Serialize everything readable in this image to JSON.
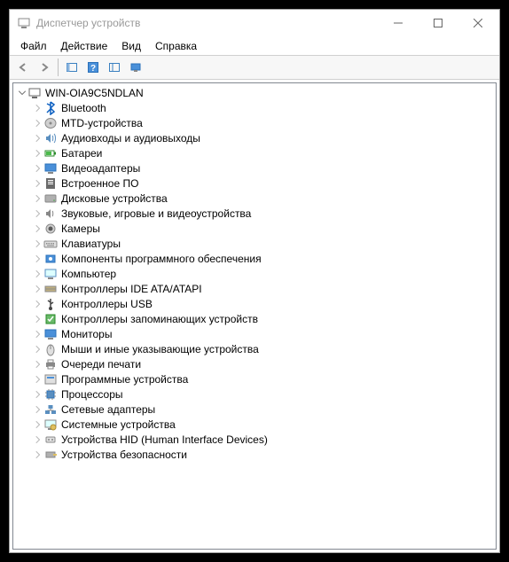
{
  "title": "Диспетчер устройств",
  "menu": [
    "Файл",
    "Действие",
    "Вид",
    "Справка"
  ],
  "root": {
    "label": "WIN-OIA9C5NDLAN",
    "icon": "computer-icon"
  },
  "categories": [
    {
      "label": "Bluetooth",
      "icon": "bluetooth-icon"
    },
    {
      "label": "MTD-устройства",
      "icon": "disk-icon"
    },
    {
      "label": "Аудиовходы и аудиовыходы",
      "icon": "audio-icon"
    },
    {
      "label": "Батареи",
      "icon": "battery-icon"
    },
    {
      "label": "Видеоадаптеры",
      "icon": "display-icon"
    },
    {
      "label": "Встроенное ПО",
      "icon": "firmware-icon"
    },
    {
      "label": "Дисковые устройства",
      "icon": "hdd-icon"
    },
    {
      "label": "Звуковые, игровые и видеоустройства",
      "icon": "sound-icon"
    },
    {
      "label": "Камеры",
      "icon": "camera-icon"
    },
    {
      "label": "Клавиатуры",
      "icon": "keyboard-icon"
    },
    {
      "label": "Компоненты программного обеспечения",
      "icon": "software-icon"
    },
    {
      "label": "Компьютер",
      "icon": "monitor-icon"
    },
    {
      "label": "Контроллеры IDE ATA/ATAPI",
      "icon": "ide-icon"
    },
    {
      "label": "Контроллеры USB",
      "icon": "usb-icon"
    },
    {
      "label": "Контроллеры запоминающих устройств",
      "icon": "storage-icon"
    },
    {
      "label": "Мониторы",
      "icon": "monitor-blue-icon"
    },
    {
      "label": "Мыши и иные указывающие устройства",
      "icon": "mouse-icon"
    },
    {
      "label": "Очереди печати",
      "icon": "printer-icon"
    },
    {
      "label": "Программные устройства",
      "icon": "software-device-icon"
    },
    {
      "label": "Процессоры",
      "icon": "cpu-icon"
    },
    {
      "label": "Сетевые адаптеры",
      "icon": "network-icon"
    },
    {
      "label": "Системные устройства",
      "icon": "system-icon"
    },
    {
      "label": "Устройства HID (Human Interface Devices)",
      "icon": "hid-icon"
    },
    {
      "label": "Устройства безопасности",
      "icon": "security-icon"
    }
  ]
}
